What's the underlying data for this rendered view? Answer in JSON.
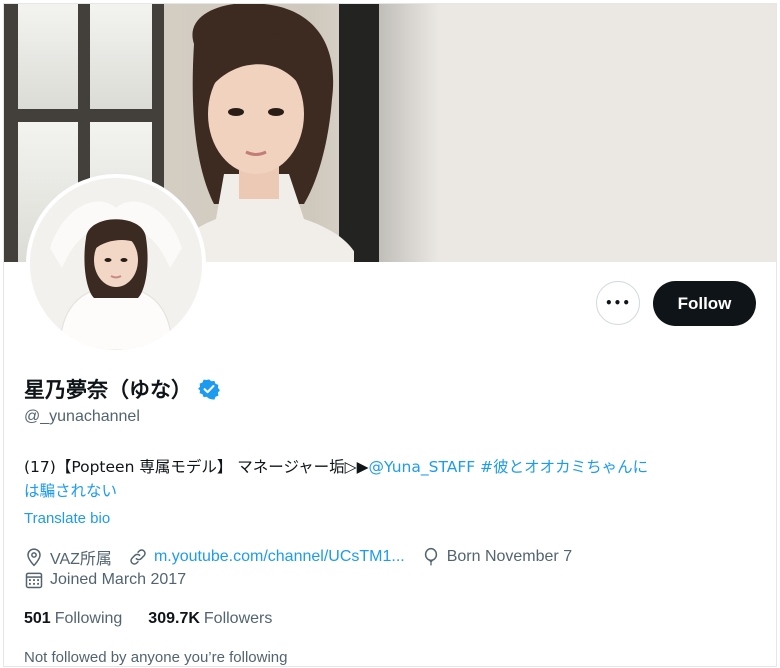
{
  "profile": {
    "display_name": "星乃夢奈（ゆな）",
    "handle": "@_yunachannel",
    "verified": true,
    "bio_prefix": "(17)【Popteen 専属モデル】 マネージャー垢▷▶",
    "bio_mention": "@Yuna_STAFF",
    "bio_hashtag_line1": " #彼とオオカミちゃんに",
    "bio_hashtag_line2": "は騙されない",
    "translate_label": "Translate bio",
    "location": "VAZ所属",
    "website": "m.youtube.com/channel/UCsTM1...",
    "birthday": "Born November 7",
    "joined": "Joined March 2017",
    "following_count": "501",
    "following_label": "Following",
    "followers_count": "309.7K",
    "followers_label": "Followers",
    "not_followed_text": "Not followed by anyone you’re following"
  },
  "actions": {
    "more_label": "•••",
    "follow_label": "Follow"
  },
  "colors": {
    "accent": "#1d9bf0",
    "text_primary": "#0f1419",
    "text_secondary": "#536471",
    "follow_bg": "#0f1419"
  },
  "icons": {
    "location": "location-pin-icon",
    "website": "link-icon",
    "birthday": "balloon-icon",
    "joined": "calendar-icon",
    "verified": "verified-badge-icon",
    "more": "more-dots-icon"
  }
}
